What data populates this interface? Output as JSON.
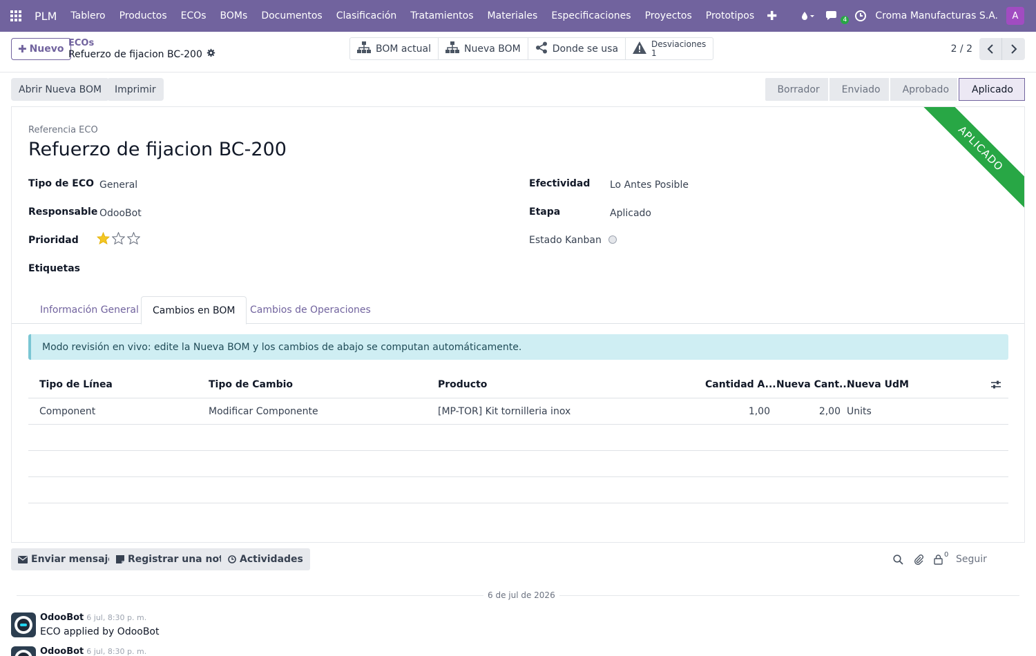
{
  "navbar": {
    "brand": "PLM",
    "menu": [
      "Tablero",
      "Productos",
      "ECOs",
      "BOMs",
      "Documentos",
      "Clasificación",
      "Tratamientos",
      "Materiales",
      "Especificaciones",
      "Proyectos",
      "Prototipos"
    ],
    "messages_badge": "4",
    "company": "Croma Manufacturas S.A.",
    "user_initial": "A"
  },
  "control": {
    "new_label": "Nuevo",
    "breadcrumb_parent": "ECOs",
    "breadcrumb_current": "Refuerzo de fijacion BC-200",
    "smart_buttons": {
      "bom_actual": "BOM actual",
      "nueva_bom": "Nueva BOM",
      "donde_se_usa": "Donde se usa",
      "desviaciones_label": "Desviaciones",
      "desviaciones_count": "1"
    },
    "pager": "2 / 2"
  },
  "statusbar": {
    "open_new_bom": "Abrir Nueva BOM",
    "print": "Imprimir",
    "stages": [
      "Borrador",
      "Enviado",
      "Aprobado",
      "Aplicado"
    ],
    "active_stage": "Aplicado"
  },
  "form": {
    "ribbon": "APLICADO",
    "ref_label": "Referencia ECO",
    "title": "Refuerzo de fijacion BC-200",
    "fields": {
      "tipo_eco_label": "Tipo de ECO",
      "tipo_eco_value": "General",
      "responsable_label": "Responsable",
      "responsable_value": "OdooBot",
      "prioridad_label": "Prioridad",
      "prioridad_value": 1,
      "prioridad_max": 3,
      "etiquetas_label": "Etiquetas",
      "efectividad_label": "Efectividad",
      "efectividad_value": "Lo Antes Posible",
      "etapa_label": "Etapa",
      "etapa_value": "Aplicado",
      "estado_kanban_label": "Estado Kanban"
    },
    "tabs": [
      "Información General",
      "Cambios en BOM",
      "Cambios de Operaciones"
    ],
    "active_tab": "Cambios en BOM",
    "alert": "Modo revisión en vivo: edite la Nueva BOM y los cambios de abajo se computan automáticamente.",
    "table": {
      "headers": [
        "Tipo de Línea",
        "Tipo de Cambio",
        "Producto",
        "Cantidad A...",
        "Nueva Cant...",
        "Nueva UdM"
      ],
      "rows": [
        [
          "Component",
          "Modificar Componente",
          "[MP-TOR] Kit tornilleria inox",
          "1,00",
          "2,00",
          "Units"
        ]
      ]
    }
  },
  "chatter": {
    "send_message": "Enviar mensaje",
    "log_note": "Registrar una nota",
    "activities": "Actividades",
    "followers_count": "0",
    "follow": "Seguir",
    "date_separator": "6 de jul de 2026",
    "messages": [
      {
        "author": "OdooBot",
        "time": "6 jul, 8:30 p. m.",
        "body": "ECO applied by OdooBot"
      },
      {
        "author": "OdooBot",
        "time": "6 jul, 8:30 p. m.",
        "body": ""
      }
    ]
  }
}
